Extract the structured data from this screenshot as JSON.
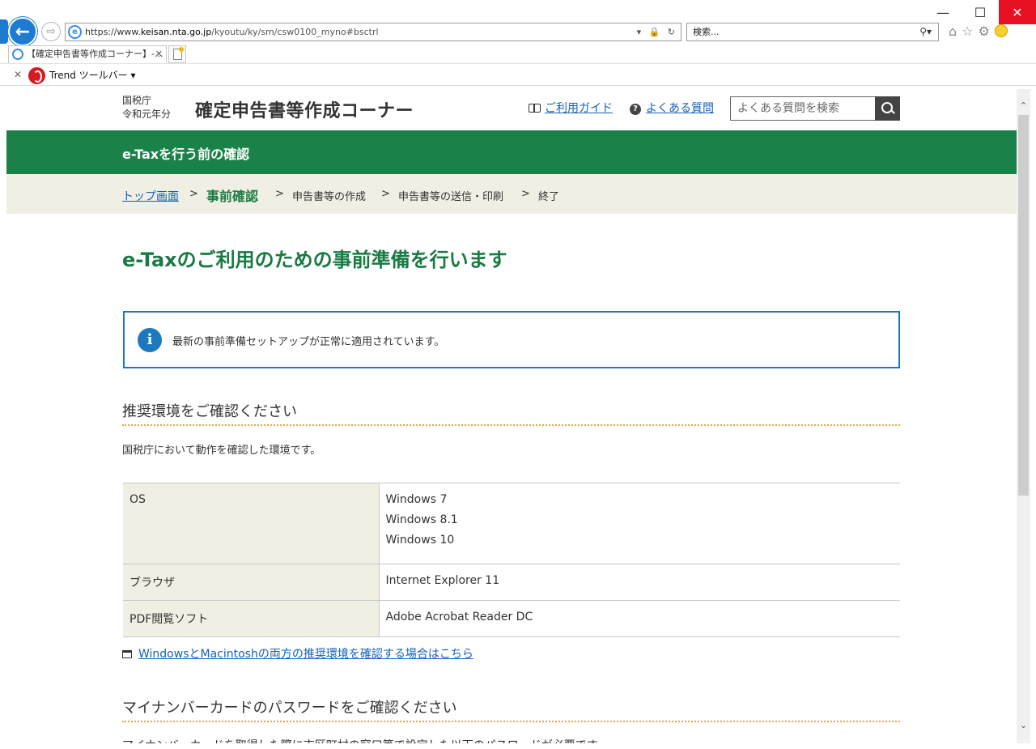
{
  "browser": {
    "url_prefix": "https://www.",
    "url_host": "keisan.nta.go.jp",
    "url_path": "/kyoutu/ky/sm/csw0100_myno#bsctrl",
    "search_placeholder": "検索...",
    "tab_title": "【確定申告書等作成コーナー】-...",
    "toolbar_label": "Trend ツールバー"
  },
  "header": {
    "agency_line1": "国税庁",
    "agency_line2": "令和元年分",
    "site_title": "確定申告書等作成コーナー",
    "guide_link": "ご利用ガイド",
    "faq_link": "よくある質問",
    "faq_search_placeholder": "よくある質問を検索"
  },
  "band": {
    "title": "e-Taxを行う前の確認"
  },
  "breadcrumb": {
    "top": "トップ画面",
    "current": "事前確認",
    "step3": "申告書等の作成",
    "step4": "申告書等の送信・印刷",
    "step5": "終了",
    "separator": ">"
  },
  "main": {
    "heading": "e-Taxのご利用のための事前準備を行います",
    "info_message": "最新の事前準備セットアップが正常に適用されています。",
    "section1_title": "推奨環境をご確認ください",
    "section1_text": "国税庁において動作を確認した環境です。",
    "env_table": {
      "os_label": "OS",
      "os_values": [
        "Windows 7",
        "Windows 8.1",
        "Windows 10"
      ],
      "browser_label": "ブラウザ",
      "browser_value": "Internet Explorer 11",
      "pdf_label": "PDF閲覧ソフト",
      "pdf_value": "Adobe Acrobat Reader DC"
    },
    "both_env_link": "WindowsとMacintoshの両方の推奨環境を確認する場合はこちら",
    "section2_title": "マイナンバーカードのパスワードをご確認ください",
    "section2_text_cut": "マイナンバーカードを取得した際に市区町村の窓口等で設定した以下のパスワードが必要です。"
  }
}
